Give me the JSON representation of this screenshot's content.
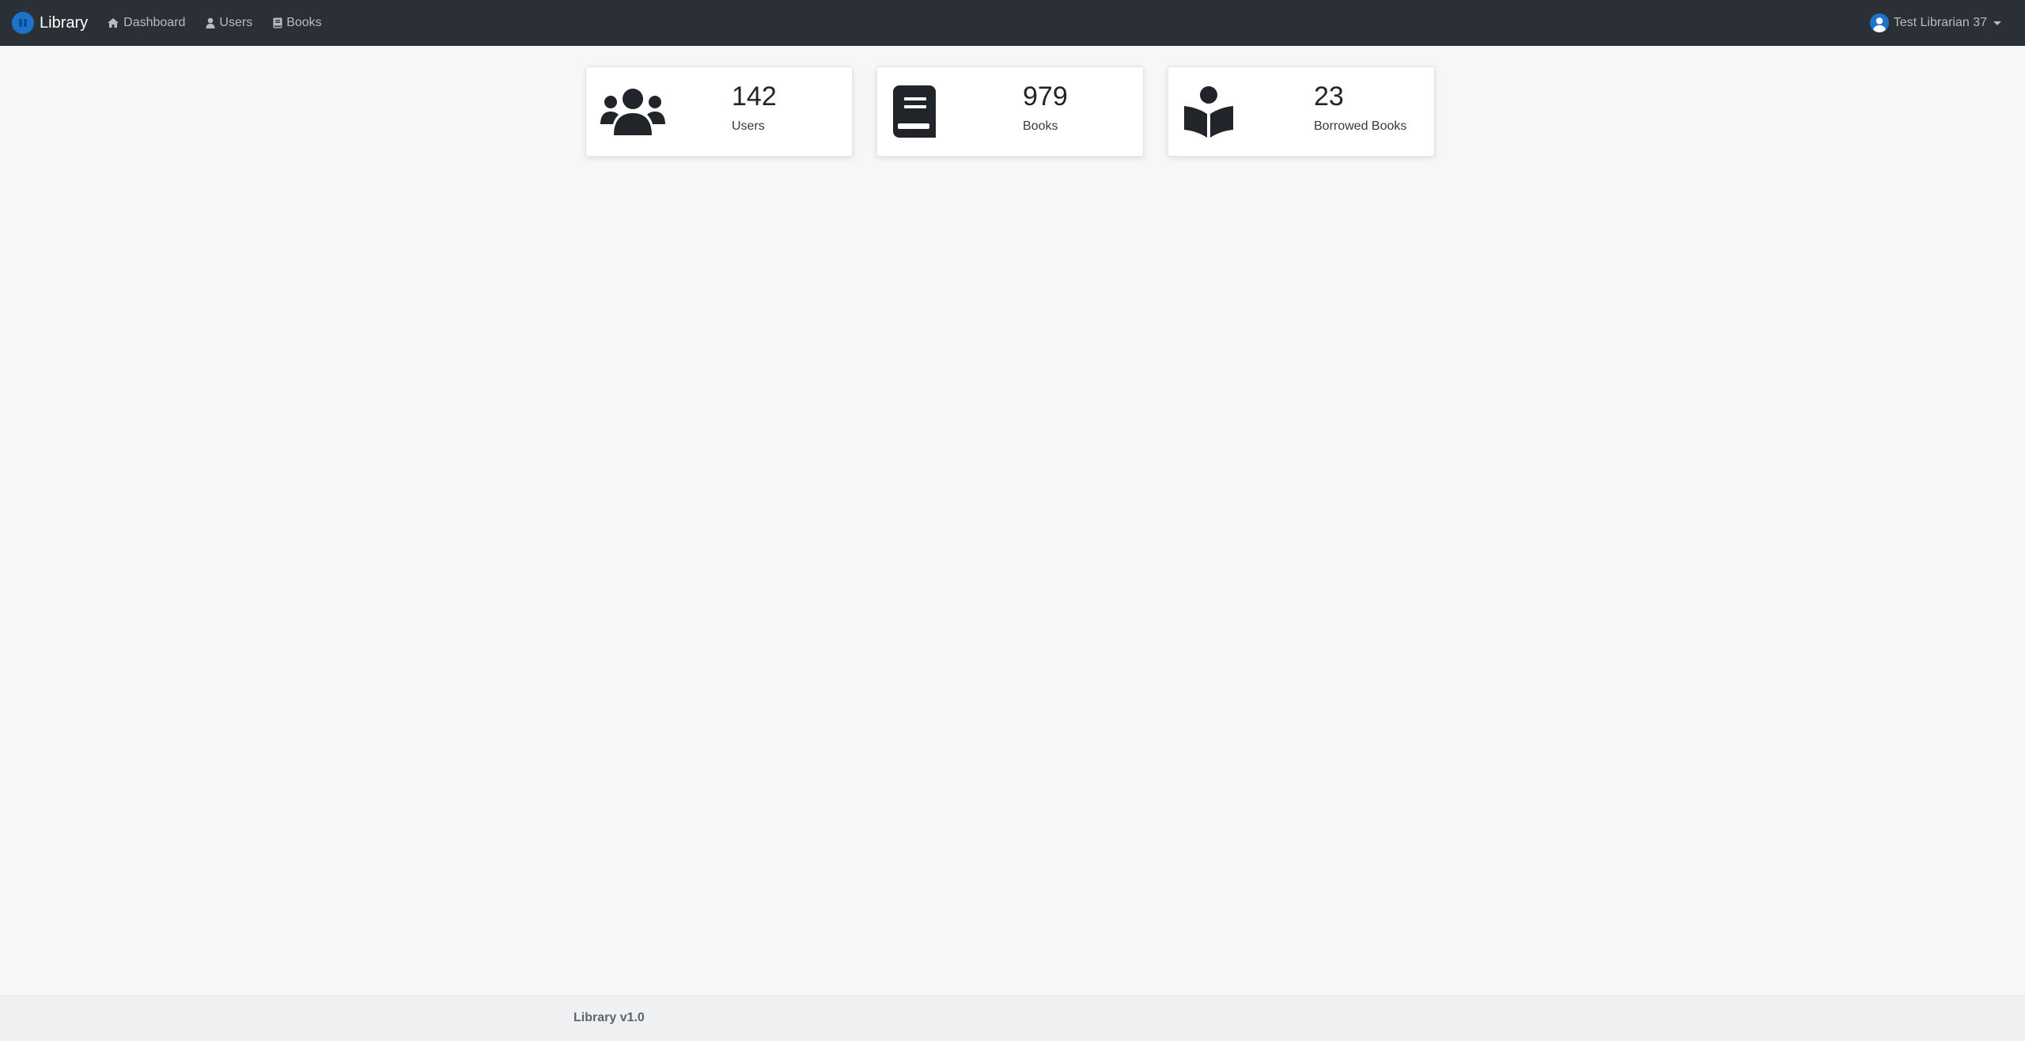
{
  "navbar": {
    "brand": "Library",
    "links": [
      {
        "label": "Dashboard",
        "icon": "home-icon"
      },
      {
        "label": "Users",
        "icon": "user-icon"
      },
      {
        "label": "Books",
        "icon": "book-icon"
      }
    ],
    "user": {
      "name": "Test Librarian 37",
      "icon": "user-circle-icon"
    }
  },
  "stats": [
    {
      "value": "142",
      "label": "Users",
      "icon": "users-icon"
    },
    {
      "value": "979",
      "label": "Books",
      "icon": "book-icon"
    },
    {
      "value": "23",
      "label": "Borrowed Books",
      "icon": "book-reader-icon"
    }
  ],
  "footer": {
    "text": "Library v1.0"
  },
  "colors": {
    "navbar_bg": "#2b2f36",
    "brand_blue": "#1d73c9",
    "page_bg": "#f6f7f9",
    "icon_dark": "#212529"
  }
}
